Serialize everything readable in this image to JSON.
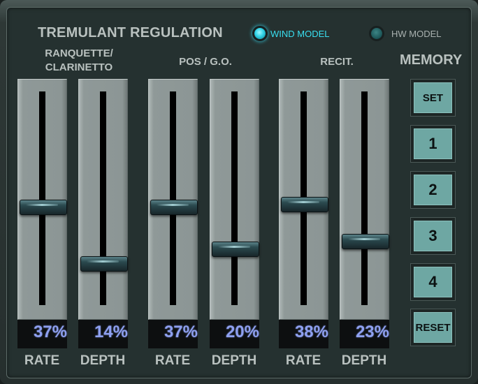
{
  "header": {
    "title": "TREMULANT REGULATION",
    "modes": {
      "wind_model": {
        "label": "WIND MODEL",
        "active": true
      },
      "hw_model": {
        "label": "HW MODEL",
        "active": false
      }
    }
  },
  "groups": [
    {
      "label": "RANQUETTE/ CLARINETTO"
    },
    {
      "label": "POS / G.O."
    },
    {
      "label": "RECIT."
    }
  ],
  "faders": [
    {
      "group": 0,
      "label": "RATE",
      "value": 37,
      "display": "37%"
    },
    {
      "group": 0,
      "label": "DEPTH",
      "value": 14,
      "display": "14%"
    },
    {
      "group": 1,
      "label": "RATE",
      "value": 37,
      "display": "37%"
    },
    {
      "group": 1,
      "label": "DEPTH",
      "value": 20,
      "display": "20%"
    },
    {
      "group": 2,
      "label": "RATE",
      "value": 38,
      "display": "38%"
    },
    {
      "group": 2,
      "label": "DEPTH",
      "value": 23,
      "display": "23%"
    }
  ],
  "memory": {
    "label": "MEMORY",
    "buttons": [
      "SET",
      "1",
      "2",
      "3",
      "4",
      "RESET"
    ]
  },
  "colors": {
    "panel_bg": "#253130",
    "label_text": "#b9c1bf",
    "value_text": "#8ea0f0",
    "active_led": "#2fd2e6",
    "memory_button": "#6ea7a3"
  }
}
